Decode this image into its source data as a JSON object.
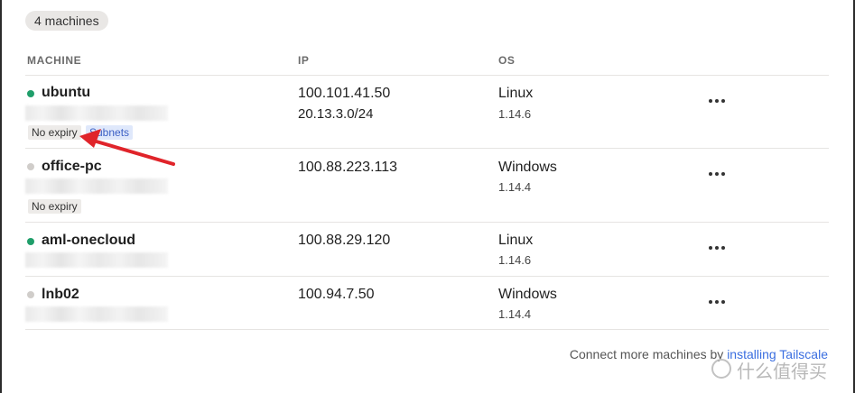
{
  "summary": {
    "machine_count": "4 machines"
  },
  "table": {
    "headers": {
      "machine": "MACHINE",
      "ip": "IP",
      "os": "OS"
    },
    "rows": [
      {
        "name": "ubuntu",
        "status": "online",
        "ips": [
          "100.101.41.50",
          "20.13.3.0/24"
        ],
        "os": "Linux",
        "version": "1.14.6",
        "badges": [
          "No expiry",
          "Subnets"
        ]
      },
      {
        "name": "office-pc",
        "status": "offline",
        "ips": [
          "100.88.223.113"
        ],
        "os": "Windows",
        "version": "1.14.4",
        "badges": [
          "No expiry"
        ]
      },
      {
        "name": "aml-onecloud",
        "status": "online",
        "ips": [
          "100.88.29.120"
        ],
        "os": "Linux",
        "version": "1.14.6",
        "badges": []
      },
      {
        "name": "lnb02",
        "status": "offline",
        "ips": [
          "100.94.7.50"
        ],
        "os": "Windows",
        "version": "1.14.4",
        "badges": []
      }
    ]
  },
  "footer": {
    "text": "Connect more machines by ",
    "link": "installing Tailscale"
  },
  "annotation": {
    "arrow_color": "#e0242a",
    "icon": "red-arrow-icon"
  },
  "colors": {
    "online": "#1f9e6a",
    "offline": "#d0cdca",
    "link": "#3a6ee0"
  },
  "watermark": {
    "text": "什么值得买",
    "icon": "smzdm-logo-icon"
  }
}
